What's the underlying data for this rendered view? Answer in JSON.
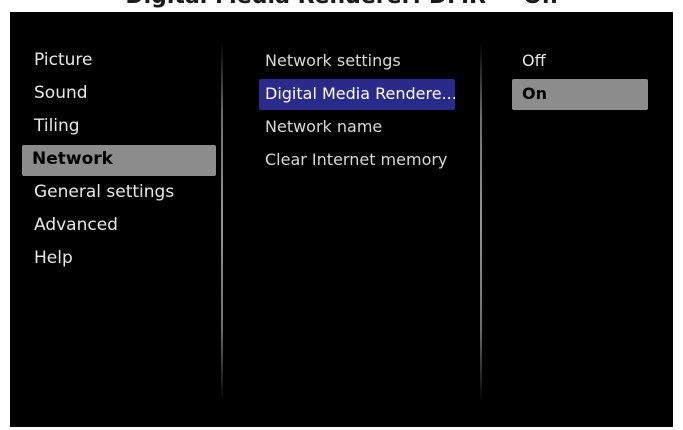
{
  "caption": "Digital Media Renderer: DMR — On",
  "menu": {
    "items": [
      {
        "label": "Picture"
      },
      {
        "label": "Sound"
      },
      {
        "label": "Tiling"
      },
      {
        "label": "Network"
      },
      {
        "label": "General settings"
      },
      {
        "label": "Advanced"
      },
      {
        "label": "Help"
      }
    ]
  },
  "network_menu": {
    "items": [
      {
        "label": "Network settings"
      },
      {
        "label": "Digital Media Rendere..."
      },
      {
        "label": "Network name"
      },
      {
        "label": "Clear Internet memory"
      }
    ]
  },
  "options": {
    "items": [
      {
        "label": "Off"
      },
      {
        "label": "On"
      }
    ]
  },
  "colors": {
    "background": "#000000",
    "selected_highlight": "#8c8c8c",
    "focus_highlight": "#2a2a8a"
  }
}
